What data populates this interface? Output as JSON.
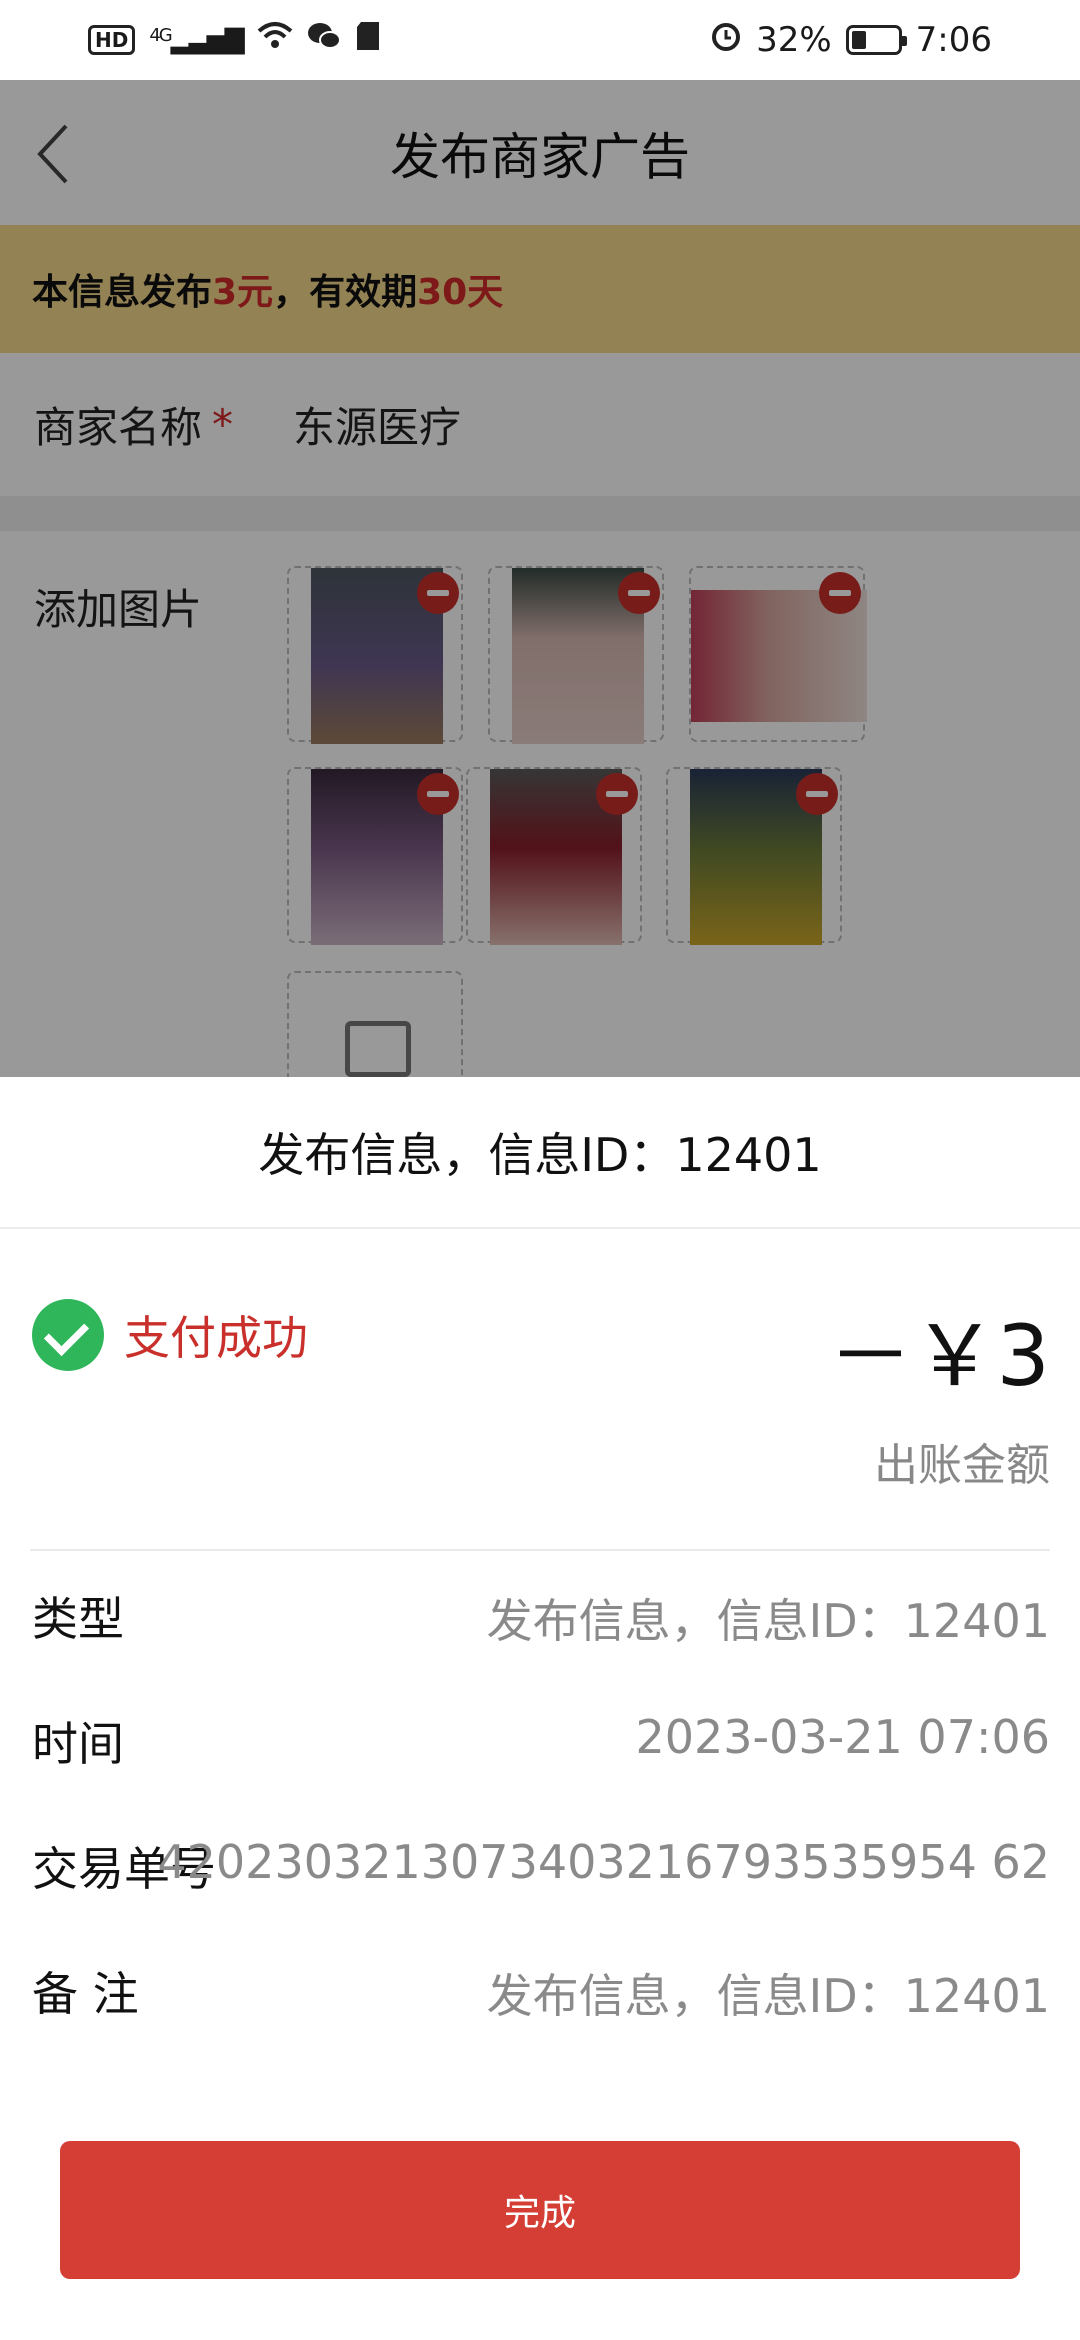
{
  "status_bar": {
    "hd": "HD",
    "net": "4G",
    "battery_text": "32%",
    "battery_level": 0.32,
    "time": "7:06"
  },
  "nav": {
    "title": "发布商家广告"
  },
  "notice": {
    "prefix": "本信息发布",
    "price": "3元",
    "mid": "，有效期",
    "days": "30天"
  },
  "form": {
    "merchant_label": "商家名称",
    "required_mark": "*",
    "merchant_value": "东源医疗",
    "photos_label": "添加图片"
  },
  "sheet": {
    "header": "发布信息，信息ID：12401",
    "status": "支付成功",
    "amount": "－￥3",
    "amount_label": "出账金额",
    "rows": [
      {
        "key": "类型",
        "value": "发布信息，信息ID：12401"
      },
      {
        "key": "时间",
        "value": "2023-03-21 07:06"
      },
      {
        "key": "交易单号",
        "value": "4202303213073403216793535954 62"
      },
      {
        "key": "备  注",
        "value": "发布信息，信息ID：12401"
      }
    ],
    "done_label": "完成"
  },
  "colors": {
    "accent_red": "#d43e34",
    "notice_bg": "#f5d98c",
    "success_green": "#2fb65a"
  }
}
